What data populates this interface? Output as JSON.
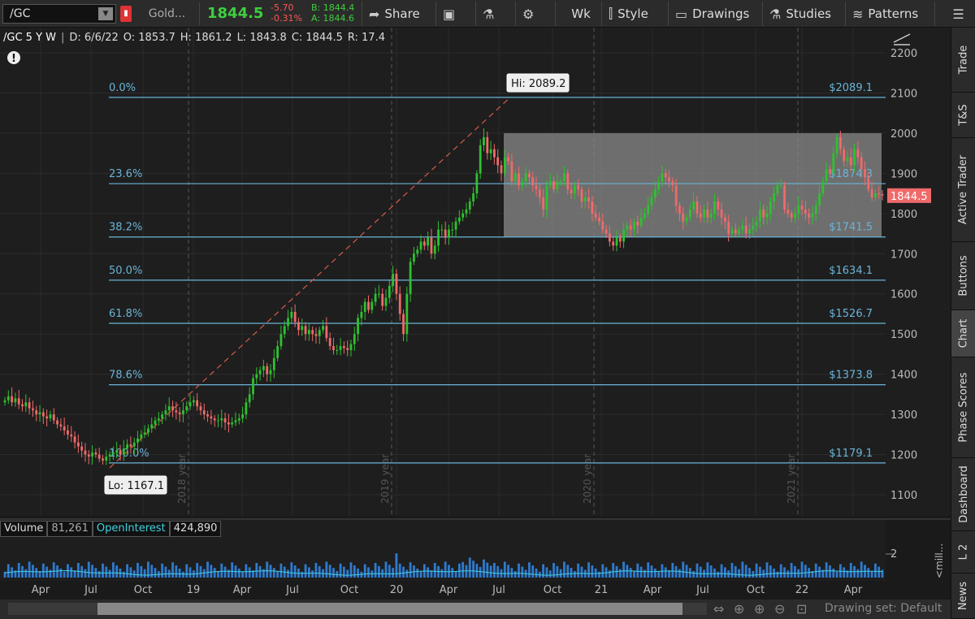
{
  "toolbar": {
    "symbol": "/GC",
    "name": "Gold...",
    "last": "1844.5",
    "change": "-5.70",
    "change_pct": "-0.31%",
    "bid": "B: 1844.4",
    "ask": "A: 1844.6",
    "share": "Share",
    "period": "Wk",
    "style": "Style",
    "drawings": "Drawings",
    "studies": "Studies",
    "patterns": "Patterns"
  },
  "header": {
    "symbol": "/GC 5 Y W",
    "date": "D: 6/6/22",
    "open": "O: 1853.7",
    "high": "H: 1861.2",
    "low": "L: 1843.8",
    "close": "C: 1844.5",
    "range": "R: 17.4"
  },
  "side_tabs": [
    "Trade",
    "T&S",
    "Active Trader",
    "Buttons",
    "Chart",
    "Phase Scores",
    "Dashboard",
    "L 2",
    "News"
  ],
  "volume": {
    "label": "Volume",
    "value": "81,261",
    "oi_label": "OpenInterest",
    "oi_value": "424,890",
    "axis_label": "2",
    "unit": "<mill..."
  },
  "scroll": {
    "drawing_set": "Drawing set: Default"
  },
  "chart_data": {
    "type": "candlestick",
    "ylim": [
      1050,
      2250
    ],
    "yticks": [
      1100,
      1200,
      1300,
      1400,
      1500,
      1600,
      1700,
      1800,
      1900,
      2000,
      2100,
      2200
    ],
    "xticks": [
      "Apr",
      "Jul",
      "Oct",
      "19",
      "Apr",
      "Jul",
      "Oct",
      "20",
      "Apr",
      "Jul",
      "Oct",
      "21",
      "Apr",
      "Jul",
      "Oct",
      "22",
      "Apr"
    ],
    "year_labels": [
      "2018 year",
      "2019 year",
      "2020 year",
      "2021 year"
    ],
    "last_price": "1844.5",
    "hi_label": "Hi: 2089.2",
    "lo_label": "Lo: 1167.1",
    "fib_levels": [
      {
        "pct": "0.0%",
        "price": "$2089.1",
        "value": 2089.1
      },
      {
        "pct": "23.6%",
        "price": "$1874.3",
        "value": 1874.3
      },
      {
        "pct": "38.2%",
        "price": "$1741.5",
        "value": 1741.5
      },
      {
        "pct": "50.0%",
        "price": "$1634.1",
        "value": 1634.1
      },
      {
        "pct": "61.8%",
        "price": "$1526.7",
        "value": 1526.7
      },
      {
        "pct": "78.6%",
        "price": "$1373.8",
        "value": 1373.8
      },
      {
        "pct": "100.0%",
        "price": "$1179.1",
        "value": 1179.1
      }
    ],
    "range_box": {
      "top": 2000,
      "bottom": 1741.5
    },
    "closes": [
      1335,
      1345,
      1330,
      1340,
      1325,
      1320,
      1330,
      1315,
      1310,
      1300,
      1305,
      1295,
      1290,
      1300,
      1285,
      1275,
      1270,
      1260,
      1250,
      1245,
      1230,
      1220,
      1210,
      1200,
      1195,
      1205,
      1200,
      1190,
      1185,
      1195,
      1200,
      1205,
      1210,
      1200,
      1215,
      1225,
      1220,
      1230,
      1240,
      1250,
      1255,
      1265,
      1275,
      1285,
      1290,
      1300,
      1310,
      1320,
      1310,
      1305,
      1300,
      1310,
      1320,
      1330,
      1335,
      1320,
      1310,
      1300,
      1295,
      1290,
      1285,
      1285,
      1290,
      1280,
      1275,
      1280,
      1285,
      1290,
      1300,
      1330,
      1350,
      1390,
      1400,
      1410,
      1420,
      1400,
      1410,
      1440,
      1470,
      1500,
      1520,
      1540,
      1555,
      1530,
      1510,
      1520,
      1500,
      1510,
      1500,
      1495,
      1510,
      1520,
      1490,
      1470,
      1460,
      1460,
      1470,
      1465,
      1460,
      1475,
      1500,
      1540,
      1555,
      1580,
      1560,
      1580,
      1600,
      1600,
      1570,
      1590,
      1620,
      1650,
      1600,
      1550,
      1500,
      1600,
      1680,
      1700,
      1710,
      1730,
      1720,
      1740,
      1700,
      1720,
      1760,
      1760,
      1740,
      1760,
      1760,
      1780,
      1790,
      1800,
      1810,
      1830,
      1850,
      1900,
      1970,
      1990,
      1950,
      1960,
      1940,
      1920,
      1900,
      1940,
      1930,
      1880,
      1900,
      1870,
      1880,
      1900,
      1890,
      1870,
      1860,
      1840,
      1810,
      1870,
      1880,
      1860,
      1880,
      1880,
      1900,
      1860,
      1850,
      1870,
      1860,
      1830,
      1840,
      1830,
      1800,
      1790,
      1780,
      1760,
      1750,
      1730,
      1720,
      1740,
      1730,
      1760,
      1770,
      1760,
      1780,
      1770,
      1790,
      1800,
      1820,
      1840,
      1860,
      1880,
      1900,
      1890,
      1880,
      1870,
      1820,
      1800,
      1780,
      1790,
      1810,
      1830,
      1800,
      1790,
      1810,
      1790,
      1800,
      1830,
      1810,
      1790,
      1780,
      1750,
      1760,
      1750,
      1760,
      1770,
      1750,
      1760,
      1770,
      1780,
      1810,
      1790,
      1800,
      1830,
      1850,
      1870,
      1870,
      1810,
      1800,
      1790,
      1800,
      1820,
      1810,
      1800,
      1790,
      1800,
      1820,
      1850,
      1880,
      1910,
      1900,
      1950,
      1990,
      1960,
      1930,
      1940,
      1920,
      1960,
      1940,
      1910,
      1890,
      1860,
      1840,
      1850,
      1848,
      1845
    ],
    "volume_max": 2.9
  }
}
